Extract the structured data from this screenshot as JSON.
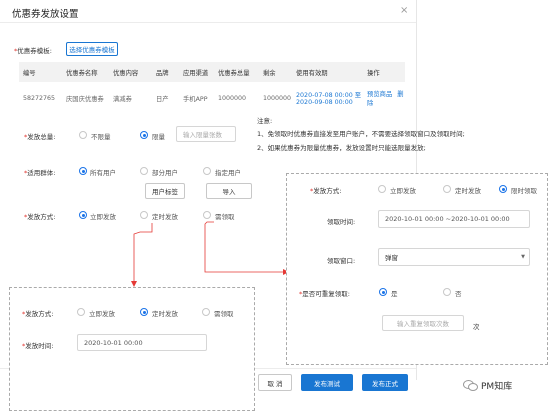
{
  "title": "优惠券发放设置",
  "template": {
    "label": "优惠券模板:",
    "button": "选择优惠券模板"
  },
  "table": {
    "headers": [
      "编号",
      "优惠券名称",
      "优惠内容",
      "品牌",
      "应用渠道",
      "优惠券总量",
      "剩余",
      "使用有效期",
      "操作"
    ],
    "row": {
      "id": "58272765",
      "name": "庆国庆优惠券",
      "content": "满减券",
      "brand": "日产",
      "channel": "手机APP",
      "total": "1000000",
      "remain": "1000000",
      "valid_from": "2020-07-08 00:00 至",
      "valid_to": "2020-09-08 00:00",
      "op_preview": "预览商品",
      "op_delete": "删除"
    }
  },
  "quantity": {
    "label": "发放总量:",
    "opt_unlimited": "不限量",
    "opt_limited": "限量",
    "placeholder": "输入限量张数"
  },
  "note": {
    "title": "注意:",
    "line1": "1、免领取时优惠券直接发至用户账户，不需要选择领取窗口及领取时间;",
    "line2": "2、如果优惠券为限量优惠券，发放设置时只能选限量发放;"
  },
  "audience": {
    "label": "适用群体:",
    "opt_all": "所有用户",
    "opt_some": "部分用户",
    "opt_specified": "指定用户",
    "btn_tags": "用户标签",
    "btn_import": "导入"
  },
  "method": {
    "label": "发放方式:",
    "opt_now": "立即发放",
    "opt_timed": "定时发放",
    "opt_claim": "需领取"
  },
  "right_panel": {
    "method_label": "发放方式:",
    "opt_now": "立即发放",
    "opt_timed": "定时发放",
    "opt_limited_claim": "限时领取",
    "time_label": "领取时间:",
    "time_value": "2020-10-01 00:00  ~2020-10-01 00:00",
    "window_label": "领取窗口:",
    "window_value": "弹窗",
    "repeat_label": "是否可重复领取:",
    "opt_yes": "是",
    "opt_no": "否",
    "repeat_placeholder": "输入重复领取次数",
    "repeat_unit": "次"
  },
  "left_panel": {
    "method_label": "发放方式:",
    "opt_now": "立即发放",
    "opt_timed": "定时发放",
    "opt_claim": "需领取",
    "time_label": "发放时间:",
    "time_value": "2020-10-01 00:00"
  },
  "footer": {
    "cancel": "取 消",
    "test": "发布测试",
    "publish": "发布正式"
  },
  "watermark": "PM知库",
  "colors": {
    "accent": "#1976d2",
    "required": "#e0312b",
    "arrow": "#e53935"
  }
}
